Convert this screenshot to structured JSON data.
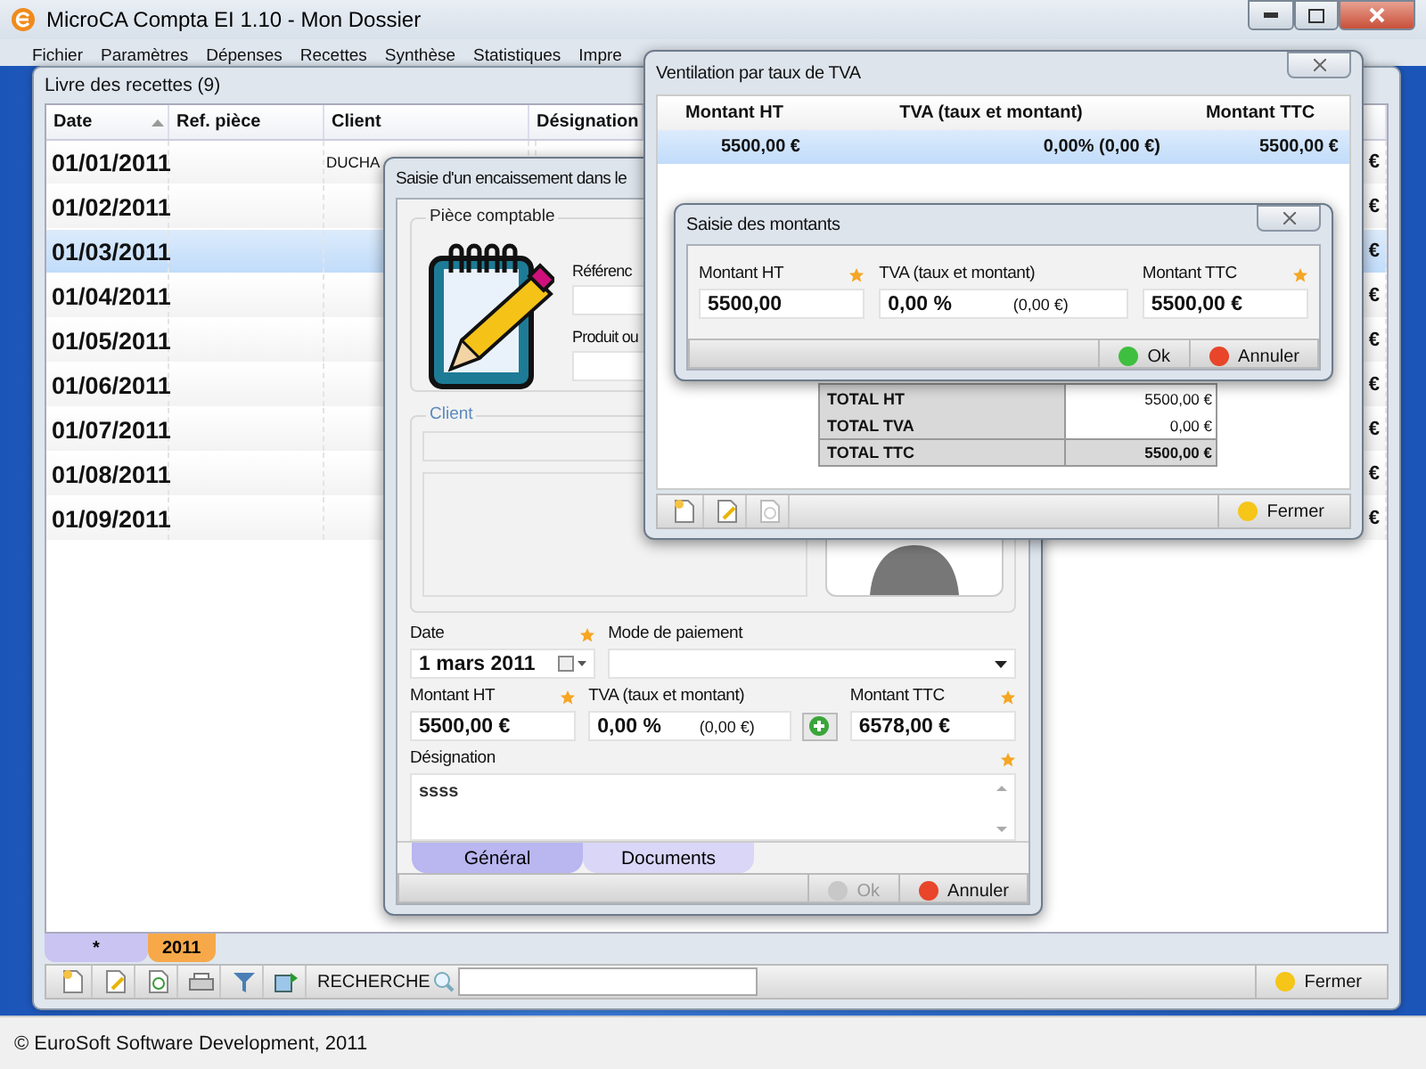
{
  "app": {
    "title": "MicroCA Compta EI 1.10 - Mon Dossier",
    "menu": [
      "Fichier",
      "Paramètres",
      "Dépenses",
      "Recettes",
      "Synthèse",
      "Statistiques",
      "Impre"
    ],
    "status": "© EuroSoft Software Development, 2011"
  },
  "ledger": {
    "title": "Livre des recettes (9)",
    "columns": [
      {
        "label": "Date",
        "sorted": true
      },
      {
        "label": "Ref. pièce",
        "sorted": false
      },
      {
        "label": "Client",
        "sorted": false
      },
      {
        "label": "Désignation",
        "sorted": false
      }
    ],
    "rows": [
      {
        "date": "01/01/2011",
        "client": "DUCHA",
        "amount": "€",
        "selected": false
      },
      {
        "date": "01/02/2011",
        "amount": "€",
        "selected": false
      },
      {
        "date": "01/03/2011",
        "amount": "€",
        "selected": true
      },
      {
        "date": "01/04/2011",
        "amount": "€",
        "selected": false
      },
      {
        "date": "01/05/2011",
        "amount": "€",
        "selected": false
      },
      {
        "date": "01/06/2011",
        "amount": "€",
        "selected": false
      },
      {
        "date": "01/07/2011",
        "amount": "€",
        "selected": false
      },
      {
        "date": "01/08/2011",
        "amount": "€",
        "selected": false
      },
      {
        "date": "01/09/2011",
        "amount": "€",
        "selected": false
      }
    ],
    "year_tabs": [
      {
        "label": "*",
        "selected": false
      },
      {
        "label": "2011",
        "selected": true
      }
    ],
    "search_label": "RECHERCHE",
    "close_button": "Fermer"
  },
  "entry_dialog": {
    "title": "Saisie d'un encaissement dans le",
    "piece_group": "Pièce comptable",
    "reference_label": "Référenc",
    "product_label": "Produit ou",
    "client_group": "Client",
    "field_rows": [
      {
        "fields": [
          {
            "kind": "date",
            "label": "Date",
            "value": "1 mars 2011",
            "required": true
          },
          {
            "kind": "select",
            "label": "Mode de paiement",
            "required": false
          }
        ]
      },
      {
        "fields": [
          {
            "kind": "amount",
            "label": "Montant HT",
            "value": "5500,00 €",
            "required": true
          },
          {
            "kind": "vat",
            "label": "TVA (taux et montant)",
            "value": "0,00 %",
            "extra": "(0,00 €)",
            "required": false
          },
          {
            "kind": "amount",
            "label": "Montant TTC",
            "value": "6578,00 €",
            "required": true
          }
        ]
      },
      {
        "fields": [
          {
            "kind": "textarea",
            "label": "Désignation",
            "value": "ssss",
            "required": true
          }
        ]
      }
    ],
    "tabs": [
      {
        "label": "Général",
        "selected": true
      },
      {
        "label": "Documents",
        "selected": false
      }
    ],
    "ok": {
      "label": "Ok",
      "disabled": true
    },
    "cancel": "Annuler"
  },
  "vat_window": {
    "title": "Ventilation par taux de TVA",
    "columns": [
      "Montant HT",
      "TVA (taux et montant)",
      "Montant TTC"
    ],
    "rows": [
      {
        "ht": "5500,00 €",
        "tva": "0,00% (0,00 €)",
        "ttc": "5500,00 €",
        "selected": true
      }
    ],
    "totals": [
      {
        "label": "TOTAL HT",
        "value": "5500,00 €",
        "emphasis": false
      },
      {
        "label": "TOTAL TVA",
        "value": "0,00 €",
        "emphasis": false
      },
      {
        "label": "TOTAL TTC",
        "value": "5500,00 €",
        "emphasis": true
      }
    ],
    "close": "Fermer"
  },
  "amounts_dialog": {
    "title": "Saisie des montants",
    "fields": [
      {
        "kind": "amount",
        "label": "Montant HT",
        "value": "5500,00",
        "required": true
      },
      {
        "kind": "vat",
        "label": "TVA (taux et montant)",
        "value": "0,00 %",
        "extra": "(0,00 €)",
        "required": false
      },
      {
        "kind": "amount",
        "label": "Montant TTC",
        "value": "5500,00 €",
        "required": true
      }
    ],
    "ok": {
      "label": "Ok",
      "disabled": false
    },
    "cancel": "Annuler"
  }
}
